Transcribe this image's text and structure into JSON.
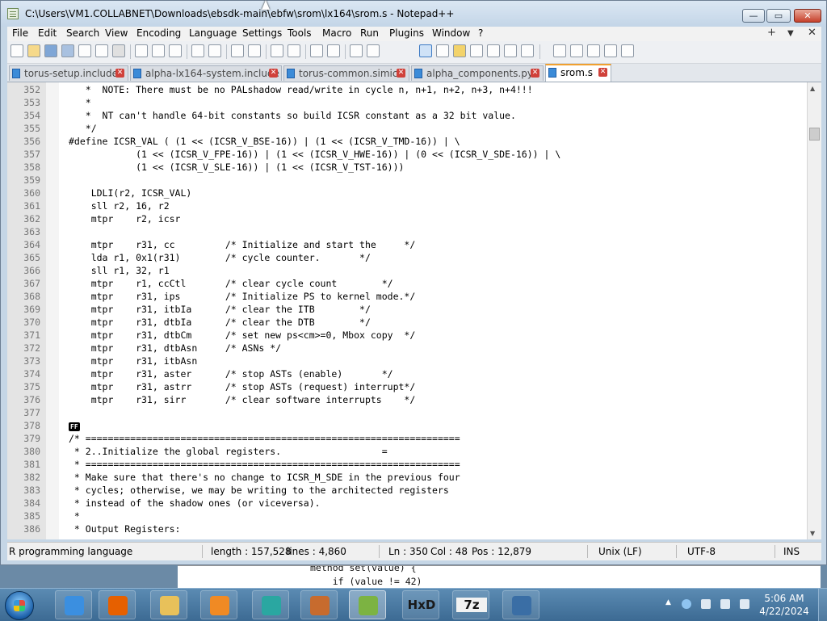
{
  "window": {
    "title": "C:\\Users\\VM1.COLLABNET\\Downloads\\ebsdk-main\\ebfw\\srom\\lx164\\srom.s - Notepad++",
    "controls": {
      "minimize": "—",
      "maximize": "▭",
      "close": "✕"
    }
  },
  "menu": {
    "items": [
      "File",
      "Edit",
      "Search",
      "View",
      "Encoding",
      "Language",
      "Settings",
      "Tools",
      "Macro",
      "Run",
      "Plugins",
      "Window",
      "?"
    ],
    "right": [
      "+",
      "▼",
      "✕"
    ]
  },
  "tabs": [
    {
      "label": "torus-setup.include",
      "active": false
    },
    {
      "label": "alpha-lx164-system.include",
      "active": false
    },
    {
      "label": "torus-common.simics",
      "active": false
    },
    {
      "label": "alpha_components.py",
      "active": false
    },
    {
      "label": "srom.s",
      "active": true
    }
  ],
  "editor": {
    "lines": [
      {
        "n": "352",
        "t": "   *  NOTE: There must be no PALshadow read/write in cycle n, n+1, n+2, n+3, n+4!!!"
      },
      {
        "n": "353",
        "t": "   *"
      },
      {
        "n": "354",
        "t": "   *  NT can't handle 64-bit constants so build ICSR constant as a 32 bit value."
      },
      {
        "n": "355",
        "t": "   */"
      },
      {
        "n": "356",
        "t": "#define ICSR_VAL ( (1 << (ICSR_V_BSE-16)) | (1 << (ICSR_V_TMD-16)) | \\"
      },
      {
        "n": "357",
        "t": "            (1 << (ICSR_V_FPE-16)) | (1 << (ICSR_V_HWE-16)) | (0 << (ICSR_V_SDE-16)) | \\"
      },
      {
        "n": "358",
        "t": "            (1 << (ICSR_V_SLE-16)) | (1 << (ICSR_V_TST-16)))"
      },
      {
        "n": "359",
        "t": ""
      },
      {
        "n": "360",
        "t": "    LDLI(r2, ICSR_VAL)"
      },
      {
        "n": "361",
        "t": "    sll r2, 16, r2"
      },
      {
        "n": "362",
        "t": "    mtpr    r2, icsr"
      },
      {
        "n": "363",
        "t": ""
      },
      {
        "n": "364",
        "t": "    mtpr    r31, cc         /* Initialize and start the     */"
      },
      {
        "n": "365",
        "t": "    lda r1, 0x1(r31)        /* cycle counter.       */"
      },
      {
        "n": "366",
        "t": "    sll r1, 32, r1"
      },
      {
        "n": "367",
        "t": "    mtpr    r1, ccCtl       /* clear cycle count        */"
      },
      {
        "n": "368",
        "t": "    mtpr    r31, ips        /* Initialize PS to kernel mode.*/"
      },
      {
        "n": "369",
        "t": "    mtpr    r31, itbIa      /* clear the ITB        */"
      },
      {
        "n": "370",
        "t": "    mtpr    r31, dtbIa      /* clear the DTB        */"
      },
      {
        "n": "371",
        "t": "    mtpr    r31, dtbCm      /* set new ps<cm>=0, Mbox copy  */"
      },
      {
        "n": "372",
        "t": "    mtpr    r31, dtbAsn     /* ASNs */"
      },
      {
        "n": "373",
        "t": "    mtpr    r31, itbAsn"
      },
      {
        "n": "374",
        "t": "    mtpr    r31, aster      /* stop ASTs (enable)       */"
      },
      {
        "n": "375",
        "t": "    mtpr    r31, astrr      /* stop ASTs (request) interrupt*/"
      },
      {
        "n": "376",
        "t": "    mtpr    r31, sirr       /* clear software interrupts    */"
      },
      {
        "n": "377",
        "t": ""
      },
      {
        "n": "378",
        "t": "FF"
      },
      {
        "n": "379",
        "t": "/* ==================================================================="
      },
      {
        "n": "380",
        "t": " * 2..Initialize the global registers.                  ="
      },
      {
        "n": "381",
        "t": " * ==================================================================="
      },
      {
        "n": "382",
        "t": " * Make sure that there's no change to ICSR_M_SDE in the previous four"
      },
      {
        "n": "383",
        "t": " * cycles; otherwise, we may be writing to the architected registers"
      },
      {
        "n": "384",
        "t": " * instead of the shadow ones (or viceversa)."
      },
      {
        "n": "385",
        "t": " *"
      },
      {
        "n": "386",
        "t": " * Output Registers:"
      }
    ]
  },
  "status": {
    "language": "R programming language",
    "length": "length : 157,528",
    "lines": "lines : 4,860",
    "ln": "Ln : 350",
    "col": "Col : 48",
    "pos": "Pos : 12,879",
    "eol": "Unix (LF)",
    "encoding": "UTF-8",
    "mode": "INS"
  },
  "background_window": {
    "line1": "method set(value) {",
    "line2": "    if (value != 42)"
  },
  "taskbar": {
    "apps": [
      {
        "name": "internet-explorer-icon",
        "color": "#3b8fe0"
      },
      {
        "name": "firefox-icon",
        "color": "#e66000"
      },
      {
        "name": "file-explorer-icon",
        "color": "#e8c15a"
      },
      {
        "name": "media-player-icon",
        "color": "#f08a24"
      },
      {
        "name": "simics-icon",
        "color": "#2aa7a1"
      },
      {
        "name": "matlab-icon",
        "color": "#c76b2e"
      },
      {
        "name": "notepadpp-icon",
        "color": "#7cb342"
      },
      {
        "name": "hxd-icon",
        "text": "HxD",
        "color": "#f0c030"
      },
      {
        "name": "sevenzip-icon",
        "text": "7z",
        "color": "#222222"
      },
      {
        "name": "remote-desktop-icon",
        "color": "#3a6ea5"
      }
    ],
    "clock": {
      "time": "5:06 AM",
      "date": "4/22/2024"
    }
  }
}
